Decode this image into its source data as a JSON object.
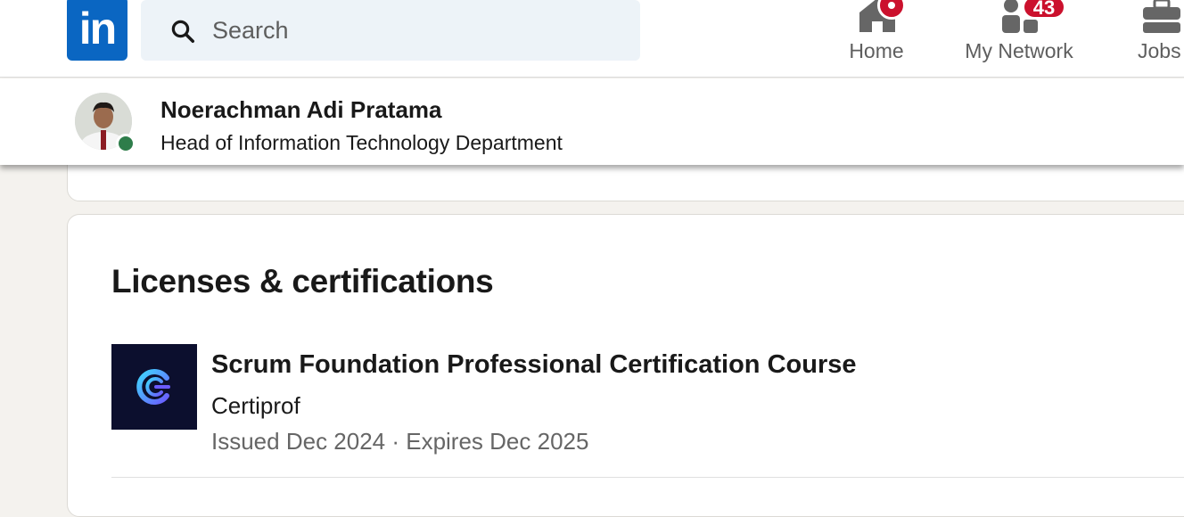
{
  "topnav": {
    "logo_text": "in",
    "search": {
      "placeholder": "Search",
      "value": ""
    },
    "items": [
      {
        "label": "Home",
        "icon": "home-icon",
        "badge": ""
      },
      {
        "label": "My Network",
        "icon": "network-icon",
        "badge": "43"
      },
      {
        "label": "Jobs",
        "icon": "briefcase-icon",
        "badge": ""
      }
    ]
  },
  "profile": {
    "name": "Noerachman Adi Pratama",
    "headline": "Head of Information Technology Department",
    "status": "online"
  },
  "section": {
    "title": "Licenses & certifications",
    "items": [
      {
        "name": "Scrum Foundation Professional Certification Course",
        "issuer": "Certiprof",
        "dates": "Issued Dec 2024 · Expires Dec 2025",
        "logo": "certiprof-logo"
      }
    ]
  },
  "colors": {
    "brand": "#0a66c2",
    "badge": "#cb112d",
    "presence": "#2e7d4a",
    "page_bg": "#f4f2ee"
  }
}
